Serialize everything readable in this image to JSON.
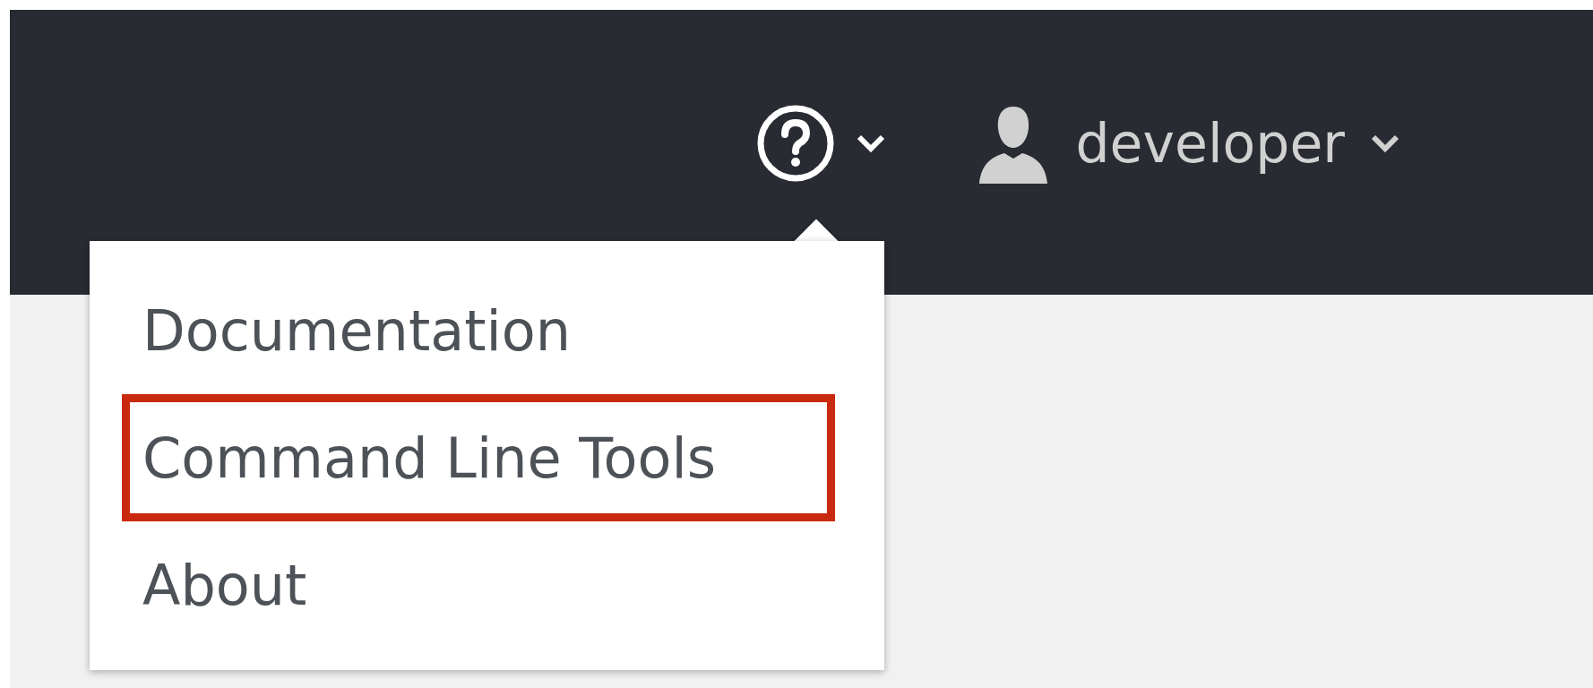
{
  "header": {
    "help_menu": {
      "expanded": true
    },
    "user_menu": {
      "username": "developer"
    }
  },
  "help_dropdown": {
    "items": [
      {
        "label": "Documentation",
        "highlighted": false
      },
      {
        "label": "Command Line Tools",
        "highlighted": true
      },
      {
        "label": "About",
        "highlighted": false
      }
    ]
  }
}
